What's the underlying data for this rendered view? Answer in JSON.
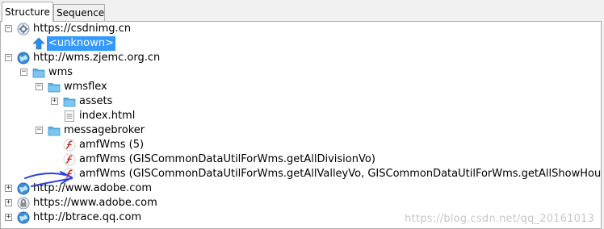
{
  "tabs": [
    {
      "label": "Structure",
      "active": true
    },
    {
      "label": "Sequence",
      "active": false
    }
  ],
  "tree": [
    {
      "level": 0,
      "expander": "minus",
      "icon": "gear-globe",
      "label": "https://csdnimg.cn"
    },
    {
      "level": 1,
      "expander": "none",
      "icon": "up-arrow",
      "label": "<unknown>",
      "selected": true
    },
    {
      "level": 0,
      "expander": "minus",
      "icon": "globe",
      "label": "http://wms.zjemc.org.cn"
    },
    {
      "level": 1,
      "expander": "minus",
      "icon": "folder",
      "label": "wms"
    },
    {
      "level": 2,
      "expander": "minus",
      "icon": "folder",
      "label": "wmsflex"
    },
    {
      "level": 3,
      "expander": "plus",
      "icon": "folder",
      "label": "assets"
    },
    {
      "level": 3,
      "expander": "none",
      "icon": "document",
      "label": "index.html"
    },
    {
      "level": 2,
      "expander": "minus",
      "icon": "folder",
      "label": "messagebroker"
    },
    {
      "level": 3,
      "expander": "none",
      "icon": "amf",
      "label": "amfWms (5)"
    },
    {
      "level": 3,
      "expander": "none",
      "icon": "amf",
      "label": "amfWms (GISCommonDataUtilForWms.getAllDivisionVo)"
    },
    {
      "level": 3,
      "expander": "none",
      "icon": "amf",
      "label": "amfWms (GISCommonDataUtilForWms.getAllValleyVo, GISCommonDataUtilForWms.getAllShowHourData, GISC"
    },
    {
      "level": 0,
      "expander": "plus",
      "icon": "globe",
      "label": "http://www.adobe.com"
    },
    {
      "level": 0,
      "expander": "plus",
      "icon": "lock-globe",
      "label": "https://www.adobe.com"
    },
    {
      "level": 0,
      "expander": "plus",
      "icon": "globe",
      "label": "http://btrace.qq.com"
    }
  ],
  "watermark": "https://blog.csdn.net/qq_20161013",
  "colors": {
    "selection": "#3399ff",
    "globe": "#3d8fd8",
    "folder": "#57b1e6",
    "amf": "#d62020",
    "annotation": "#2a3fd8"
  }
}
